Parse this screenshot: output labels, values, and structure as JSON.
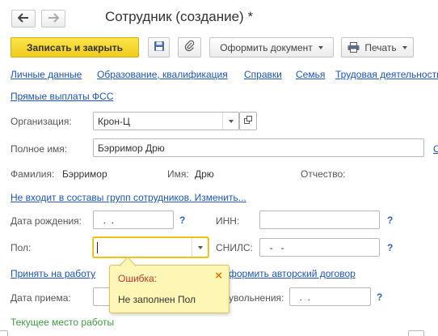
{
  "window": {
    "title": "Сотрудник (создание) *"
  },
  "nav": {
    "back_icon": "arrow-left-icon",
    "forward_icon": "arrow-right-icon"
  },
  "toolbar": {
    "save_close_label": "Записать и закрыть",
    "save_icon": "floppy-disk-icon",
    "attach_icon": "paperclip-icon",
    "make_doc_label": "Оформить документ",
    "print_label": "Печать",
    "print_icon": "printer-icon",
    "accent_color": "#f3d02a"
  },
  "tabs": [
    "Личные данные",
    "Образование, квалификация",
    "Справки",
    "Семья",
    "Трудовая деятельность"
  ],
  "fss_link": "Прямые выплаты ФСС",
  "form": {
    "org_label": "Организация:",
    "org_value": "Крон-Ц",
    "fullname_label": "Полное имя:",
    "fullname_value": "Бэрримор Дрю",
    "fullname_extra": "С",
    "surname_label": "Фамилия:",
    "surname_value": "Бэрримор",
    "name_label": "Имя:",
    "name_value": "Дрю",
    "patronymic_label": "Отчество:",
    "groups_link": "Не входит в составы групп сотрудников. Изменить...",
    "birth_label": "Дата рождения:",
    "birth_value": "  .  .",
    "inn_label": "ИНН:",
    "gender_label": "Пол:",
    "gender_value": "",
    "snils_label": "СНИЛС:",
    "snils_value": "  -   -",
    "hire_link": "Принять на работу",
    "contract_link": "формить авторский договор",
    "hire_date_label": "Дата приема:",
    "dismiss_label": "увольнения:",
    "dismiss_value": "  .  .",
    "current_place_label": "Текущее место работы",
    "help": "?"
  },
  "tooltip": {
    "title": "Ошибка:",
    "message": "Не заполнен Пол",
    "close": "×",
    "background": "#fdf6b4",
    "title_color": "#c0392b"
  }
}
